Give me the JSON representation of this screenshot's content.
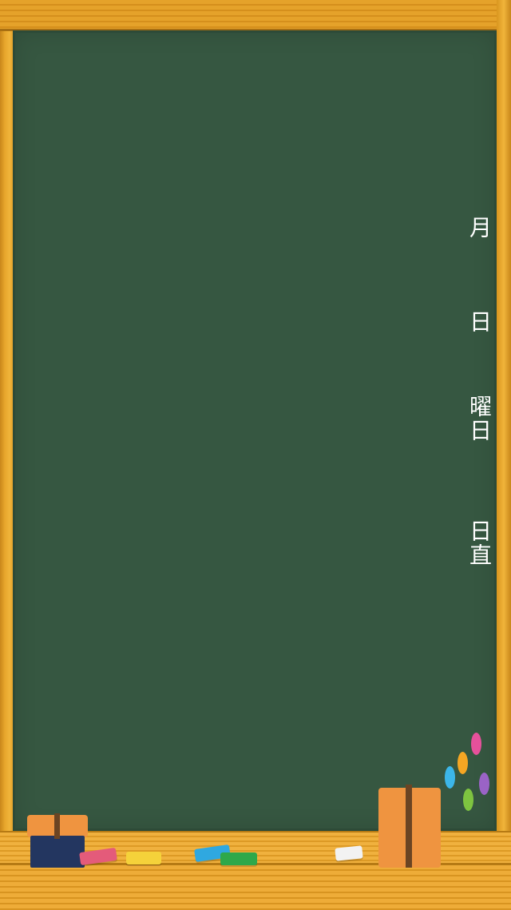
{
  "board": {
    "labels": {
      "month": "月",
      "day": "日",
      "weekday": "曜日",
      "duty": "日直"
    }
  },
  "colors": {
    "board": "#365741",
    "frame": "#e7a431",
    "chalk_text": "#ffffff"
  },
  "chalks": [
    {
      "color": "#e45b7a"
    },
    {
      "color": "#f5d23a"
    },
    {
      "color": "#2fa8e0"
    },
    {
      "color": "#2ea84a"
    },
    {
      "color": "#f2f2f2"
    }
  ],
  "magnets": [
    {
      "color": "#e6519b"
    },
    {
      "color": "#f5a623"
    },
    {
      "color": "#3cb6e8"
    },
    {
      "color": "#9a63c6"
    },
    {
      "color": "#7ec440"
    }
  ]
}
